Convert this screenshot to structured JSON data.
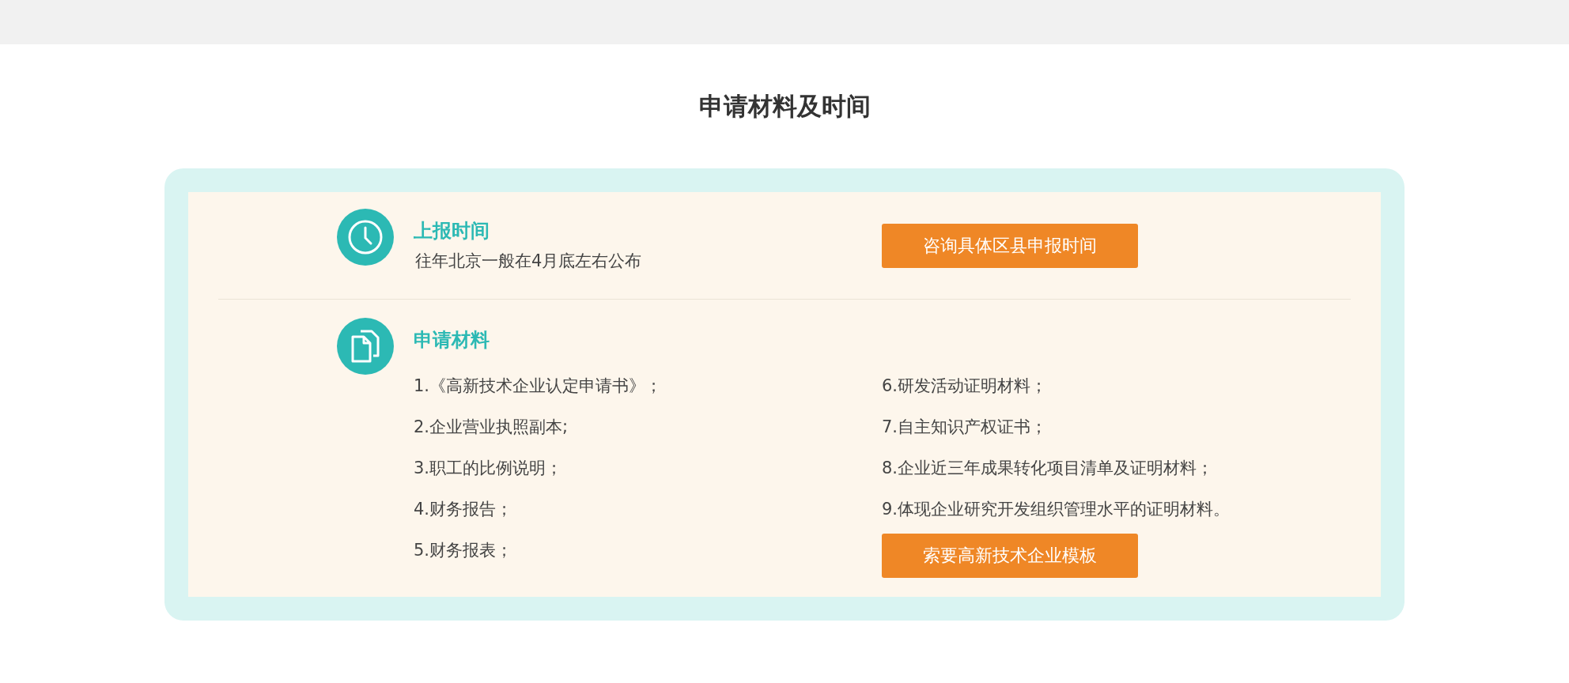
{
  "heading": "申请材料及时间",
  "sections": [
    {
      "kind": "time",
      "title": "上报时间",
      "description": "往年北京一般在4月底左右公布",
      "button": "咨询具体区县申报时间"
    },
    {
      "kind": "materials",
      "title": "申请材料",
      "columns": [
        [
          "1.《高新技术企业认定申请书》；",
          "2.企业营业执照副本;",
          "3.职工的比例说明；",
          "4.财务报告；",
          "5.财务报表；"
        ],
        [
          "6.研发活动证明材料；",
          "7.自主知识产权证书；",
          "8.企业近三年成果转化项目清单及证明材料；",
          "9.体现企业研究开发组织管理水平的证明材料。"
        ]
      ],
      "button": "索要高新技术企业模板"
    }
  ]
}
